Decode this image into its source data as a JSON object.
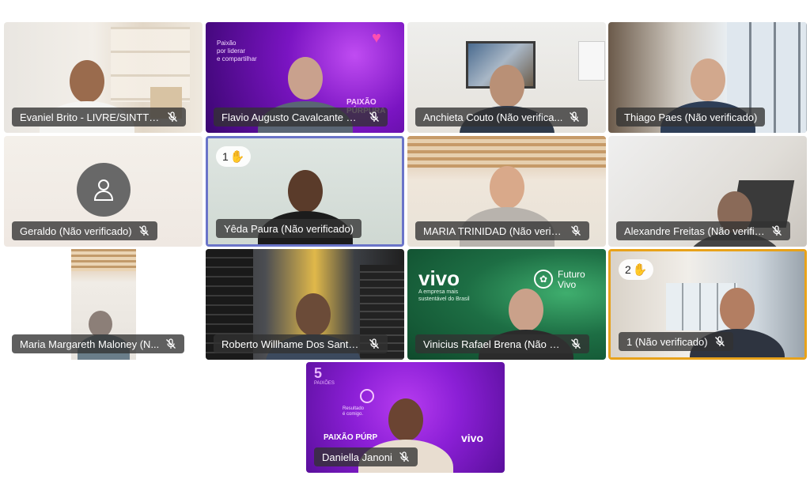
{
  "participants": [
    {
      "name": "Evaniel Brito - LIVRE/SINTTEL"
    },
    {
      "name": "Flavio Augusto Cavalcante Ro..."
    },
    {
      "name": "Anchieta Couto (Não verifica..."
    },
    {
      "name": "Thiago Paes (Não verificado)"
    },
    {
      "name": "Geraldo (Não verificado)"
    },
    {
      "name": "Yêda Paura (Não verificado)",
      "hand": "1"
    },
    {
      "name": "MARIA TRINIDAD (Não verifi..."
    },
    {
      "name": "Alexandre Freitas (Não verific..."
    },
    {
      "name": "Maria Margareth Maloney (N..."
    },
    {
      "name": "Roberto Willhame Dos Santo..."
    },
    {
      "name": "Vinicius Rafael Brena (Não ve..."
    },
    {
      "name": "1 (Não verificado)",
      "hand": "2"
    },
    {
      "name": "Daniella Janoni"
    }
  ],
  "backgrounds": {
    "paixao_slogan": "Paixão\npor liderar\ne compartilhar",
    "paixao_purpura": "PAIXÃO PÚRPURA",
    "vivo_brand": "vivo",
    "vivo_tagline": "A empresa mais sustentável do Brasil",
    "futuro_vivo": "Futuro Vivo",
    "cinco": "5",
    "paixoes": "PAIXÕES",
    "paixao_purp_short": "PAIXÃO PÚRP",
    "resultado": "Resultado é comigo.",
    "vivo_small": "vivo"
  },
  "colors": {
    "active_speaker_blue": "#6a74c9",
    "raised_hand_gold": "#e8a21a",
    "purple": "#8b1fd6"
  },
  "icons": {
    "mic_off": "mic-off-icon",
    "hand": "raised-hand-icon",
    "avatar": "person-icon"
  }
}
